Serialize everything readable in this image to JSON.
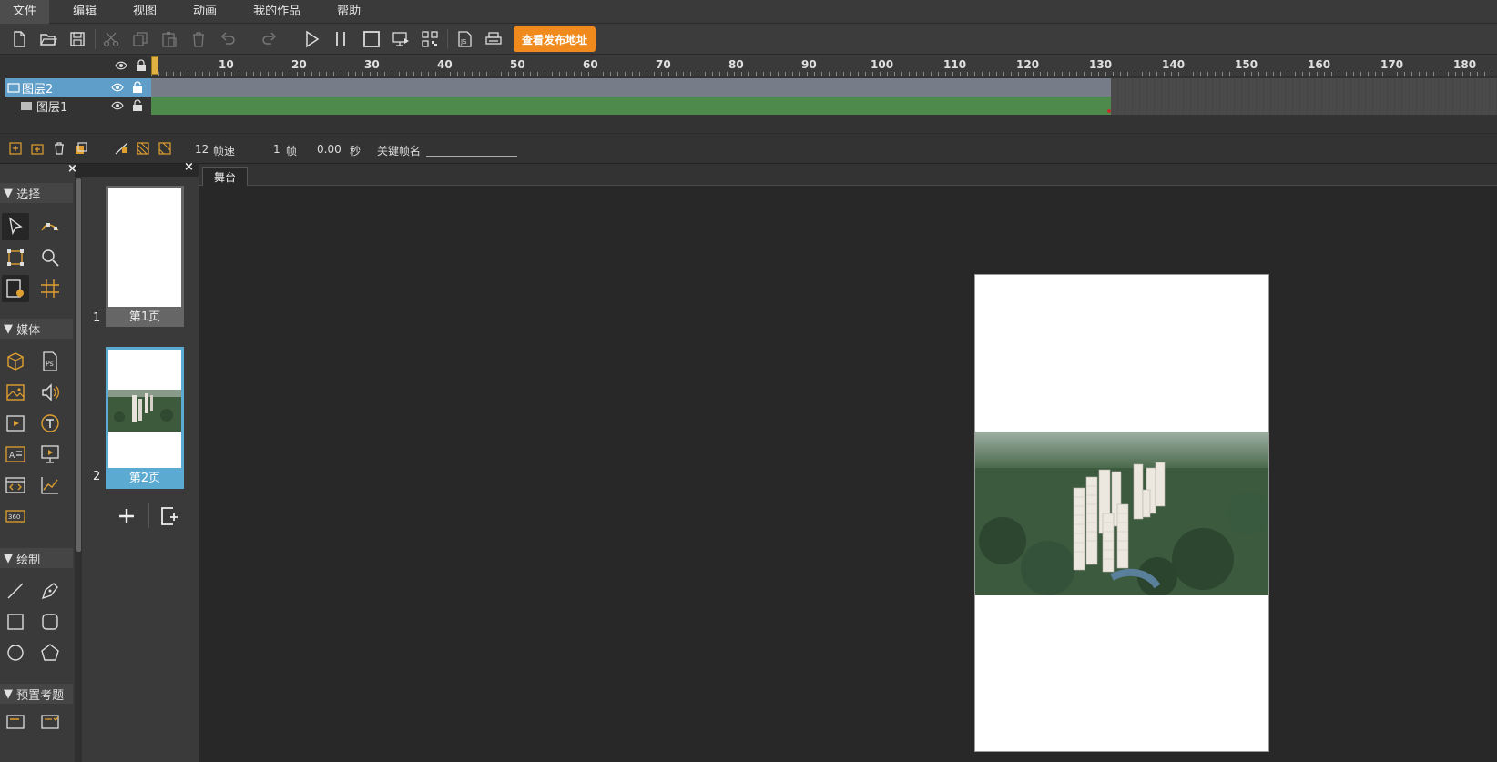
{
  "menu": {
    "items": [
      "文件",
      "编辑",
      "视图",
      "动画",
      "我的作品",
      "帮助"
    ]
  },
  "toolbar": {
    "publish_label": "查看发布地址",
    "icons": [
      "new-file-icon",
      "open-folder-icon",
      "save-icon",
      "cut-icon",
      "copy-icon",
      "paste-icon",
      "delete-icon",
      "undo-icon",
      "redo-icon",
      "play-icon",
      "pause-icon",
      "stop-icon",
      "preview-icon",
      "qrcode-icon",
      "js-icon",
      "print-icon"
    ],
    "accent": "#f08a1c"
  },
  "timeline": {
    "ruler_labels": [
      "10",
      "20",
      "30",
      "40",
      "50",
      "60",
      "70",
      "80",
      "90",
      "100",
      "110",
      "120",
      "130",
      "140",
      "150",
      "160",
      "170",
      "180"
    ],
    "layers": [
      {
        "name": "图层2",
        "selected": true
      },
      {
        "name": "图层1",
        "selected": false
      }
    ],
    "fps_value": "12",
    "fps_label": "帧速",
    "frame_value": "1",
    "frame_label": "帧",
    "time_value": "0.00",
    "time_label": "秒",
    "keyframe_label": "关键帧名"
  },
  "tools": {
    "sections": [
      "选择",
      "媒体",
      "绘制",
      "预置考题"
    ]
  },
  "pages": {
    "items": [
      {
        "num": "1",
        "label": "第1页",
        "selected": false
      },
      {
        "num": "2",
        "label": "第2页",
        "selected": true
      }
    ]
  },
  "stage": {
    "tab_label": "舞台"
  }
}
